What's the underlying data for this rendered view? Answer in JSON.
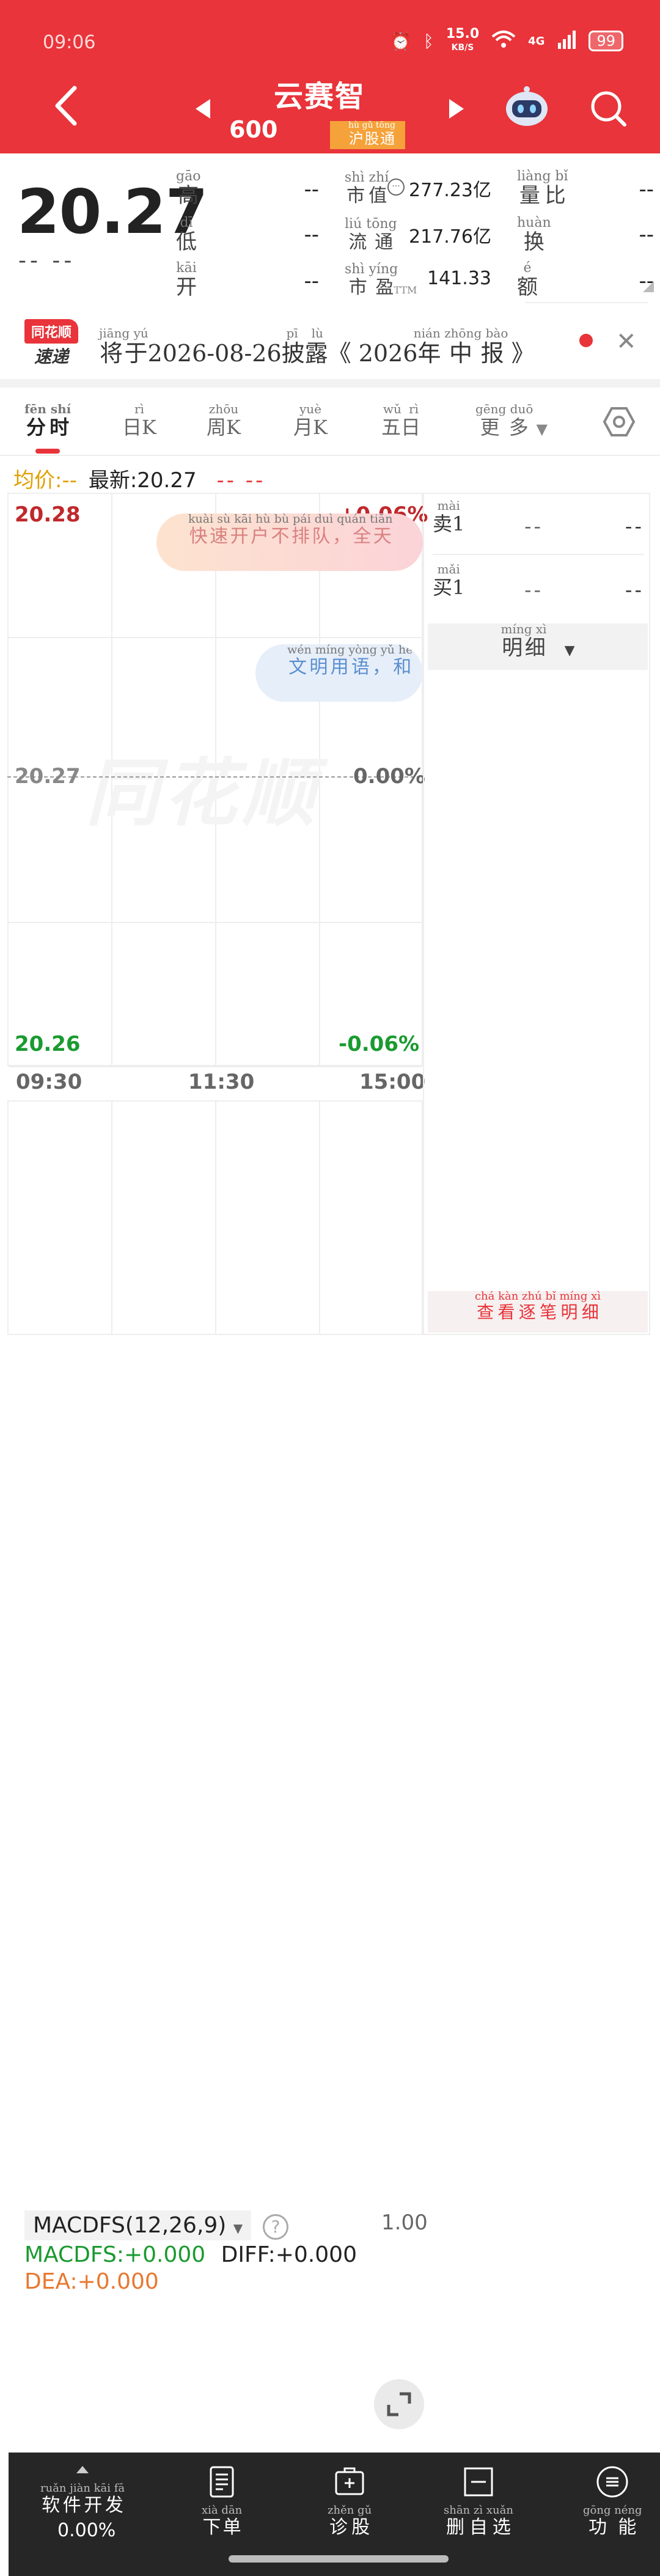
{
  "status_bar": {
    "time": "09:06",
    "net_speed": "15.0",
    "net_unit": "KB/S",
    "network": "4G",
    "battery": "99"
  },
  "header": {
    "stock_name": "云赛智",
    "stock_code": "600",
    "market_tag": {
      "text": "沪股通",
      "pinyin": "hù gǔ tōng"
    }
  },
  "quote": {
    "price": "20.27",
    "change": "-- --",
    "fields": [
      {
        "label": "高",
        "pinyin": "gāo",
        "value": "--"
      },
      {
        "label": "低",
        "pinyin": "dī",
        "value": "--"
      },
      {
        "label": "开",
        "pinyin": "kāi",
        "value": "--"
      },
      {
        "label": "市值",
        "pinyin": "shì zhí",
        "value": "277.23亿"
      },
      {
        "label": "流通",
        "pinyin": "liú tōng",
        "value": "217.76亿"
      },
      {
        "label": "市盈",
        "pinyin": "shì yíng",
        "suffix": "TTM",
        "value": "141.33"
      },
      {
        "label": "量比",
        "pinyin": "liàng bǐ",
        "value": "--"
      },
      {
        "label": "换",
        "pinyin": "huàn",
        "value": "--"
      },
      {
        "label": "额",
        "pinyin": "é",
        "value": "--"
      }
    ]
  },
  "notice": {
    "logo_top": "同花顺",
    "logo_bottom": "速递",
    "text_parts": [
      {
        "t": "将于",
        "p": "jiāng yú"
      },
      {
        "t": "2026-08-26",
        "p": ""
      },
      {
        "t": "披露",
        "p": "pī lù"
      },
      {
        "t": "《 2026",
        "p": ""
      },
      {
        "t": "年中报",
        "p": "nián zhōng bào"
      },
      {
        "t": " 》",
        "p": ""
      }
    ]
  },
  "tabs": [
    {
      "label": "分时",
      "pinyin": "fēn shí"
    },
    {
      "label": "日K",
      "pinyin": "rì"
    },
    {
      "label": "周K",
      "pinyin": "zhōu"
    },
    {
      "label": "月K",
      "pinyin": "yuè"
    },
    {
      "label": "五日",
      "pinyin": "wǔ rì"
    },
    {
      "label": "更多",
      "pinyin": "gēng duō"
    }
  ],
  "summary": {
    "avg_label": "均价:",
    "avg_value": "--",
    "latest": "最新:20.27",
    "change": "-- --"
  },
  "chart": {
    "watermark": "同花顺",
    "y_top_left": "20.28",
    "y_top_right": "+0.06%",
    "y_mid_left": "20.27",
    "y_mid_right": "0.00%",
    "y_bottom_left": "20.26",
    "y_bottom_right": "-0.06%",
    "x_labels": [
      "09:30",
      "11:30",
      "15:00"
    ],
    "bubble1": {
      "text": "快速开户不排队，全天",
      "pinyin": "kuài sù kāi hù bù pái duì quán tiān"
    },
    "bubble2": {
      "text": "文明用语，和",
      "pinyin": "wén míng yòng yǔ hé"
    }
  },
  "orderbook": {
    "sell1": {
      "label": "卖1",
      "pinyin": "mài",
      "price": "--",
      "volume": "--"
    },
    "buy1": {
      "label": "买1",
      "pinyin": "mǎi",
      "price": "--",
      "volume": "--"
    },
    "detail_label": "明细",
    "detail_pinyin": "míng xì",
    "view_label": "查看逐笔明细",
    "view_pinyin": "chá kàn zhú bǐ míng xì"
  },
  "macd": {
    "indicator": "MACDFS(12,26,9)",
    "scale": "1.00",
    "macdfs": "MACDFS:+0.000",
    "diff": "DIFF:+0.000",
    "dea": "DEA:+0.000"
  },
  "bottom_bar": {
    "items": [
      {
        "label": "软件开发",
        "pinyin": "ruǎn jiàn kāi fā",
        "icon": "up-arrow-icon"
      },
      {
        "label": "下单",
        "pinyin": "xià dān",
        "icon": "order-icon"
      },
      {
        "label": "诊股",
        "pinyin": "zhěn gǔ",
        "icon": "diagnose-icon"
      },
      {
        "label": "删自选",
        "pinyin": "shān zì xuǎn",
        "icon": "remove-watchlist-icon"
      },
      {
        "label": "功能",
        "pinyin": "gōng néng",
        "icon": "menu-icon"
      }
    ],
    "percent": "0.00%"
  },
  "colors": {
    "brand_red": "#e8343a",
    "up": "#c0282c",
    "down": "#1a9a30",
    "avg": "#e0a000",
    "dea": "#e87830"
  }
}
